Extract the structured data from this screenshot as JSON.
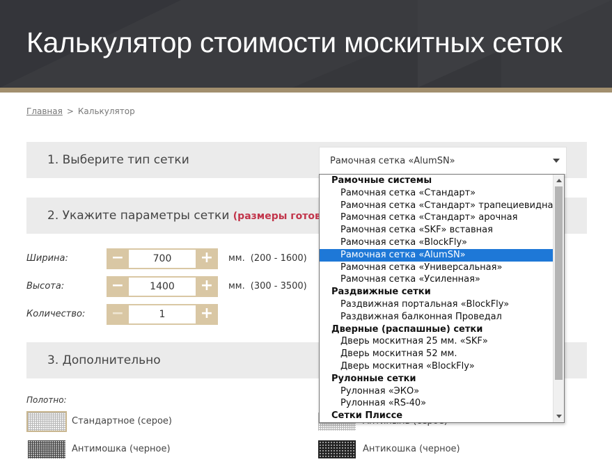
{
  "header": {
    "title": "Калькулятор стоимости москитных сеток"
  },
  "breadcrumb": {
    "home": "Главная",
    "separator": ">",
    "current": "Калькулятор"
  },
  "section1": {
    "title": "1. Выберите тип сетки",
    "selected": "Рамочная сетка «AlumSN»"
  },
  "section2": {
    "title": "2. Укажите параметры сетки",
    "note": "(размеры готовой к"
  },
  "params": {
    "width": {
      "label": "Ширина:",
      "value": "700",
      "unit": "мм.",
      "range": "(200 - 1600)"
    },
    "height": {
      "label": "Высота:",
      "value": "1400",
      "unit": "мм.",
      "range": "(300 - 3500)"
    },
    "qty": {
      "label": "Количество:",
      "value": "1"
    },
    "minus": "−",
    "plus": "+"
  },
  "section3": {
    "title": "3. Дополнительно"
  },
  "polotno": {
    "label": "Полотно:",
    "items": [
      "Стандартное (серое)",
      "Антимошка (черное)",
      "Антикошка (черное)"
    ],
    "hidden_item_partial": "Антипыль (серое)"
  },
  "dropdown": {
    "groups": [
      {
        "label": "Рамочные системы",
        "options": [
          "Рамочная сетка «Стандарт»",
          "Рамочная сетка «Стандарт» трапециевидная",
          "Рамочная сетка «Стандарт» арочная",
          "Рамочная сетка «SKF» вставная",
          "Рамочная сетка «BlockFly»",
          "Рамочная сетка «AlumSN»",
          "Рамочная сетка «Универсальная»",
          "Рамочная сетка «Усиленная»"
        ]
      },
      {
        "label": "Раздвижные сетки",
        "options": [
          "Раздвижная портальная «BlockFly»",
          "Раздвижная балконная Проведал"
        ]
      },
      {
        "label": "Дверные (распашные) сетки",
        "options": [
          "Дверь москитная 25 мм. «SKF»",
          "Дверь москитная 52 мм.",
          "Дверь москитная «BlockFly»"
        ]
      },
      {
        "label": "Рулонные сетки",
        "options": [
          "Рулонная «ЭКО»",
          "Рулонная «RS-40»"
        ]
      },
      {
        "label": "Сетки Плиссе",
        "options": []
      }
    ],
    "highlighted": "Рамочная сетка «AlumSN»"
  },
  "colors": {
    "accent": "#a28f6e",
    "header_bg": "#3a3b3f",
    "stepper": "#d9c7a4",
    "highlight": "#1e78d7",
    "note_red": "#c2354b"
  },
  "icons": {
    "select_arrow": "chevron-down-icon",
    "minus": "minus-icon",
    "plus": "plus-icon"
  }
}
